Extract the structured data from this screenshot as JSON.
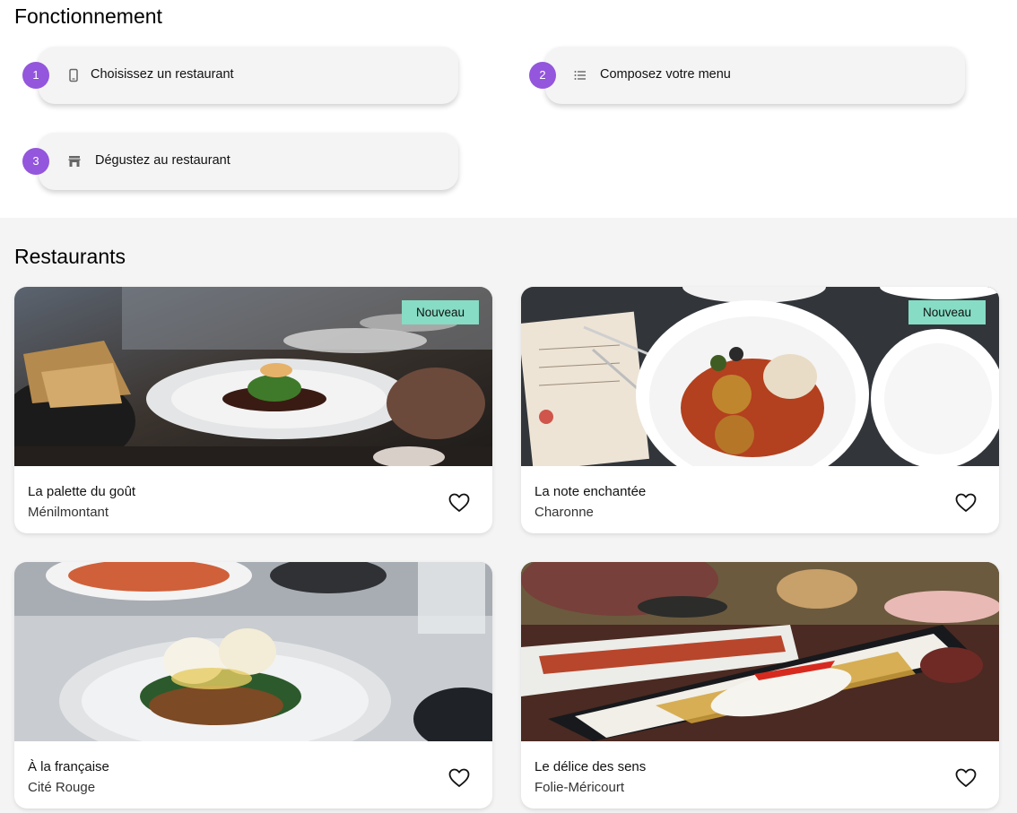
{
  "how_it_works": {
    "title": "Fonctionnement",
    "steps": [
      {
        "number": "1",
        "icon": "phone-icon",
        "label": "Choisissez un restaurant"
      },
      {
        "number": "2",
        "icon": "list-icon",
        "label": "Composez votre menu"
      },
      {
        "number": "3",
        "icon": "store-icon",
        "label": "Dégustez au restaurant"
      }
    ]
  },
  "restaurants": {
    "title": "Restaurants",
    "new_label": "Nouveau",
    "items": [
      {
        "name": "La palette du goût",
        "area": "Ménilmontant",
        "is_new": true,
        "favorite_icon": "heart-outline-icon"
      },
      {
        "name": "La note enchantée",
        "area": "Charonne",
        "is_new": true,
        "favorite_icon": "heart-outline-icon"
      },
      {
        "name": "À la française",
        "area": "Cité Rouge",
        "is_new": false,
        "favorite_icon": "heart-outline-icon"
      },
      {
        "name": "Le délice des sens",
        "area": "Folie-Méricourt",
        "is_new": false,
        "favorite_icon": "heart-outline-icon"
      }
    ]
  },
  "colors": {
    "accent": "#9356dc",
    "new_tag": "#86dcc4",
    "section_bg": "#f4f4f4"
  }
}
